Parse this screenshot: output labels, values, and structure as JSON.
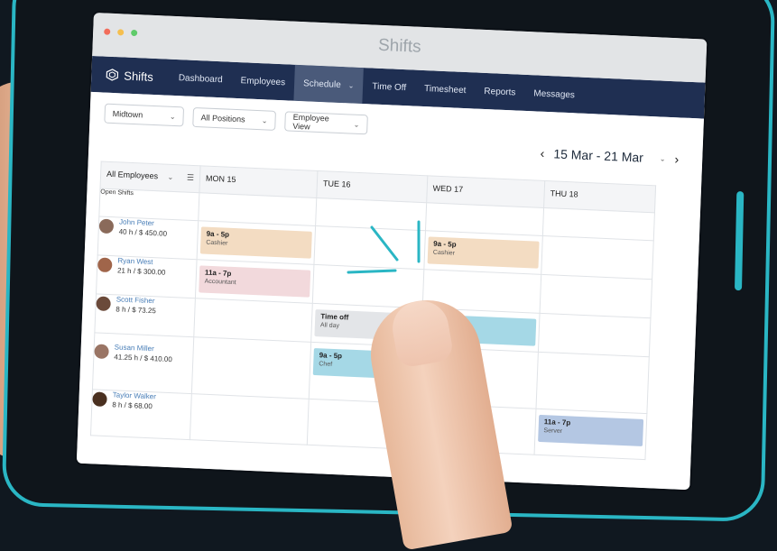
{
  "window": {
    "title": "Shifts"
  },
  "nav": {
    "brand": "Shifts",
    "items": [
      "Dashboard",
      "Employees",
      "Schedule",
      "Time Off",
      "Timesheet",
      "Reports",
      "Messages"
    ],
    "active": "Schedule"
  },
  "filters": {
    "location": "Midtown",
    "positions": "All Positions",
    "view": "Employee View"
  },
  "date_range": {
    "label": "15 Mar - 21 Mar"
  },
  "grid": {
    "employee_filter": "All Employees",
    "days": [
      "MON 15",
      "TUE 16",
      "WED 17",
      "THU 18"
    ],
    "open_shifts_label": "Open Shifts",
    "employees": [
      {
        "name": "John Peter",
        "hours": "40 h / $ 450.00"
      },
      {
        "name": "Ryan West",
        "hours": "21 h / $ 300.00"
      },
      {
        "name": "Scott Fisher",
        "hours": "8 h / $ 73.25"
      },
      {
        "name": "Susan Miller",
        "hours": "41.25 h / $ 410.00"
      },
      {
        "name": "Taylor Walker",
        "hours": "8 h / $ 68.00"
      }
    ],
    "shifts": {
      "john_mon": {
        "time": "9a - 5p",
        "role": "Cashier"
      },
      "john_wed": {
        "time": "9a - 5p",
        "role": "Cashier"
      },
      "ryan_mon": {
        "time": "11a - 7p",
        "role": "Accountant"
      },
      "scott_tue": {
        "time": "Time off",
        "role": "All day"
      },
      "scott_wed": {
        "time": "9a - 5p",
        "role": "Chef"
      },
      "susan_tue": {
        "time": "9a - 5p",
        "role": "Chef"
      },
      "taylor_thu": {
        "time": "11a - 7p",
        "role": "Server"
      }
    }
  },
  "colors": {
    "accent": "#2ab6c4",
    "nav": "#1f2f52",
    "cashier": "#f3dcc2",
    "accountant": "#f2d9dc",
    "chef": "#a5d8e6",
    "server": "#b4c7e3",
    "timeoff": "#e3e5e8"
  }
}
